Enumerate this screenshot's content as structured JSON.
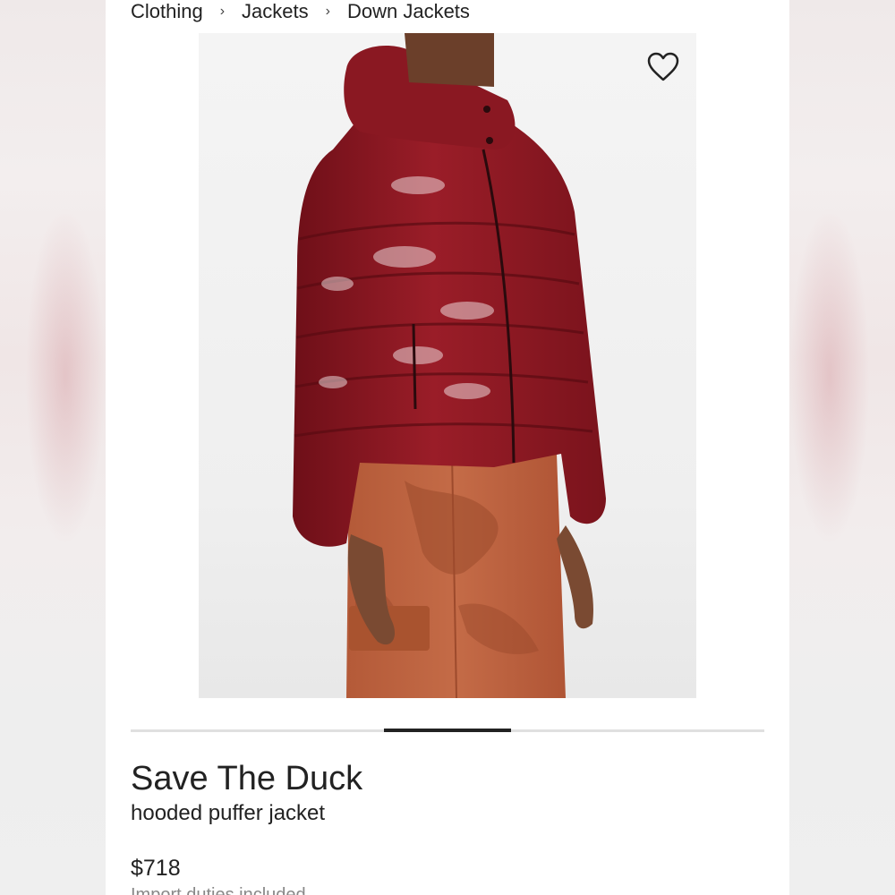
{
  "breadcrumb": {
    "items": [
      "Clothing",
      "Jackets",
      "Down Jackets"
    ],
    "separator": "›"
  },
  "product": {
    "brand": "Save The Duck",
    "name": "hooded puffer jacket",
    "price": "$718",
    "duties_note": "Import duties included",
    "image_alt": "Model wearing a glossy red hooded puffer jacket with orange camouflage cargo trousers"
  },
  "wishlist": {
    "icon": "heart-outline-icon",
    "favorited": false
  },
  "carousel": {
    "current_position_fraction": 0.4,
    "indicator_width_fraction": 0.2
  },
  "colors": {
    "jacket": "#8e1a24",
    "trousers": "#b9603e",
    "text": "#222222",
    "muted_text": "#888888",
    "indicator": "#222222"
  }
}
